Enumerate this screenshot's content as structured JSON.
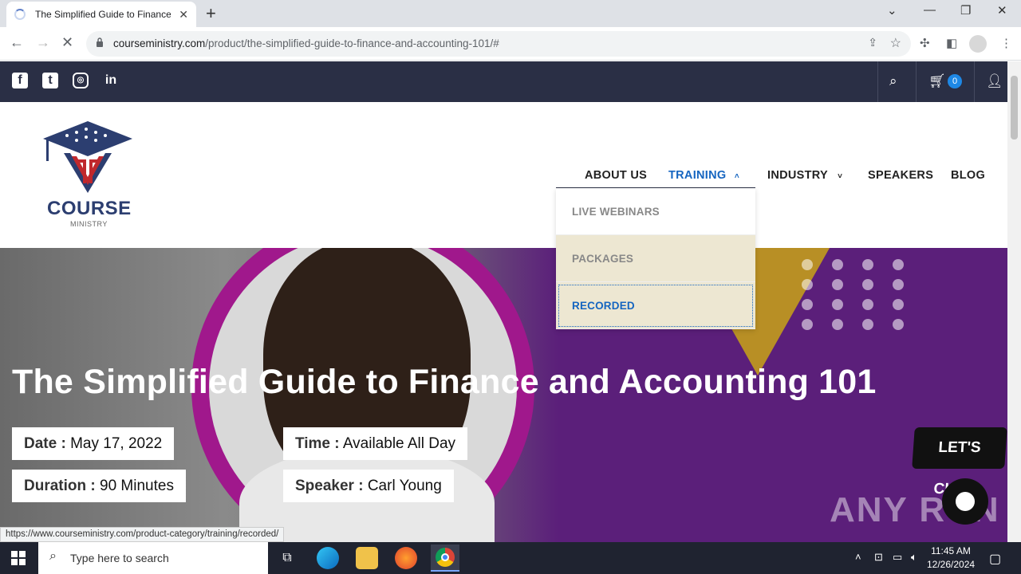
{
  "browser": {
    "tab_title": "The Simplified Guide to Finance",
    "new_tab": "+",
    "url_host": "courseministry.com",
    "url_path": "/product/the-simplified-guide-to-finance-and-accounting-101/#",
    "status_url": "https://www.courseministry.com/product-category/training/recorded/"
  },
  "site": {
    "cart_count": "0",
    "logo_title": "COURSE",
    "logo_subtitle": "MINISTRY",
    "nav": {
      "about": "ABOUT US",
      "training": "TRAINING",
      "industry": "INDUSTRY",
      "speakers": "SPEAKERS",
      "blog": "BLOG"
    },
    "training_menu": [
      "LIVE WEBINARS",
      "PACKAGES",
      "RECORDED"
    ]
  },
  "product": {
    "title": "The Simplified Guide to Finance and Accounting 101",
    "date_label": "Date :",
    "date_value": "May 17, 2022",
    "time_label": "Time :",
    "time_value": "Available All Day",
    "duration_label": "Duration :",
    "duration_value": "90 Minutes",
    "speaker_label": "Speaker :",
    "speaker_value": "Carl Young"
  },
  "chat": {
    "label": "LET'S CHAT!"
  },
  "watermark": "ANY RUN",
  "taskbar": {
    "search_placeholder": "Type here to search",
    "time": "11:45 AM",
    "date": "12/26/2024"
  },
  "colors": {
    "topbar": "#2a2f45",
    "accent": "#1565c0",
    "hero": "#5b1f7a"
  }
}
